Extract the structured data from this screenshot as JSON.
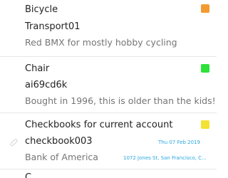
{
  "items": [
    {
      "title": "Bicycle",
      "code": "Transport01",
      "description": "Red BMX for mostly hobby cycling",
      "color": "#f39b32"
    },
    {
      "title": "Chair",
      "code": "ai69cd6k",
      "description": "Bought in 1996, this is older than the kids!",
      "color": "#2ee23a"
    },
    {
      "title": "Checkbooks for current account",
      "code": "checkbook003",
      "description": "Bank of America",
      "color": "#f3e133",
      "date": "Thu 07 Feb 2019",
      "address": "1072 Jones St, San Francisco, C...",
      "icon": "paperclip-icon"
    },
    {
      "title": "C..."
    }
  ]
}
